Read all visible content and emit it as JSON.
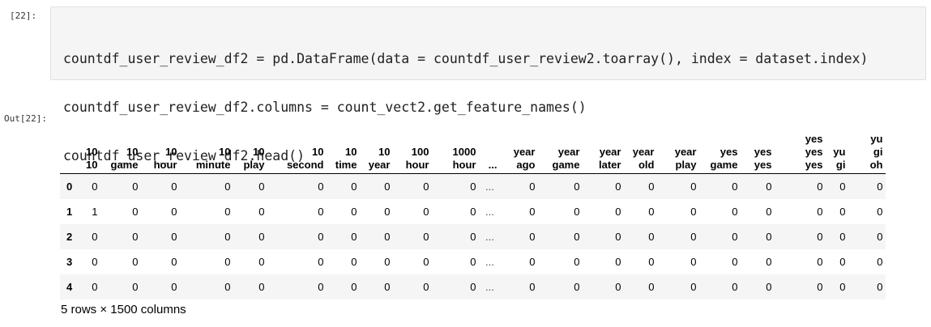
{
  "input_cell": {
    "prompt": "[22]:",
    "code_lines": [
      "countdf_user_review_df2 = pd.DataFrame(data = countdf_user_review2.toarray(), index = dataset.index)",
      "countdf_user_review_df2.columns = count_vect2.get_feature_names()",
      "countdf_user_review_df2.head()"
    ]
  },
  "output_cell": {
    "prompt": "Out[22]:",
    "table": {
      "columns": [
        [
          "10",
          "10"
        ],
        [
          "10",
          "game"
        ],
        [
          "10",
          "hour"
        ],
        [
          "10",
          "minute"
        ],
        [
          "10",
          "play"
        ],
        [
          "10",
          "second"
        ],
        [
          "10",
          "time"
        ],
        [
          "10",
          "year"
        ],
        [
          "100",
          "hour"
        ],
        [
          "1000",
          "hour"
        ],
        [
          "..."
        ],
        [
          "year",
          "ago"
        ],
        [
          "year",
          "game"
        ],
        [
          "year",
          "later"
        ],
        [
          "year",
          "old"
        ],
        [
          "year",
          "play"
        ],
        [
          "yes",
          "game"
        ],
        [
          "yes",
          "yes"
        ],
        [
          "yes",
          "yes",
          "yes"
        ],
        [
          "yu",
          "gi"
        ],
        [
          "yu",
          "gi",
          "oh"
        ]
      ],
      "rows": [
        {
          "index": "0",
          "cells": [
            "0",
            "0",
            "0",
            "0",
            "0",
            "0",
            "0",
            "0",
            "0",
            "0",
            "...",
            "0",
            "0",
            "0",
            "0",
            "0",
            "0",
            "0",
            "0",
            "0",
            "0"
          ]
        },
        {
          "index": "1",
          "cells": [
            "1",
            "0",
            "0",
            "0",
            "0",
            "0",
            "0",
            "0",
            "0",
            "0",
            "...",
            "0",
            "0",
            "0",
            "0",
            "0",
            "0",
            "0",
            "0",
            "0",
            "0"
          ]
        },
        {
          "index": "2",
          "cells": [
            "0",
            "0",
            "0",
            "0",
            "0",
            "0",
            "0",
            "0",
            "0",
            "0",
            "...",
            "0",
            "0",
            "0",
            "0",
            "0",
            "0",
            "0",
            "0",
            "0",
            "0"
          ]
        },
        {
          "index": "3",
          "cells": [
            "0",
            "0",
            "0",
            "0",
            "0",
            "0",
            "0",
            "0",
            "0",
            "0",
            "...",
            "0",
            "0",
            "0",
            "0",
            "0",
            "0",
            "0",
            "0",
            "0",
            "0"
          ]
        },
        {
          "index": "4",
          "cells": [
            "0",
            "0",
            "0",
            "0",
            "0",
            "0",
            "0",
            "0",
            "0",
            "0",
            "...",
            "0",
            "0",
            "0",
            "0",
            "0",
            "0",
            "0",
            "0",
            "0",
            "0"
          ]
        }
      ],
      "shape_text": "5 rows × 1500 columns"
    }
  }
}
